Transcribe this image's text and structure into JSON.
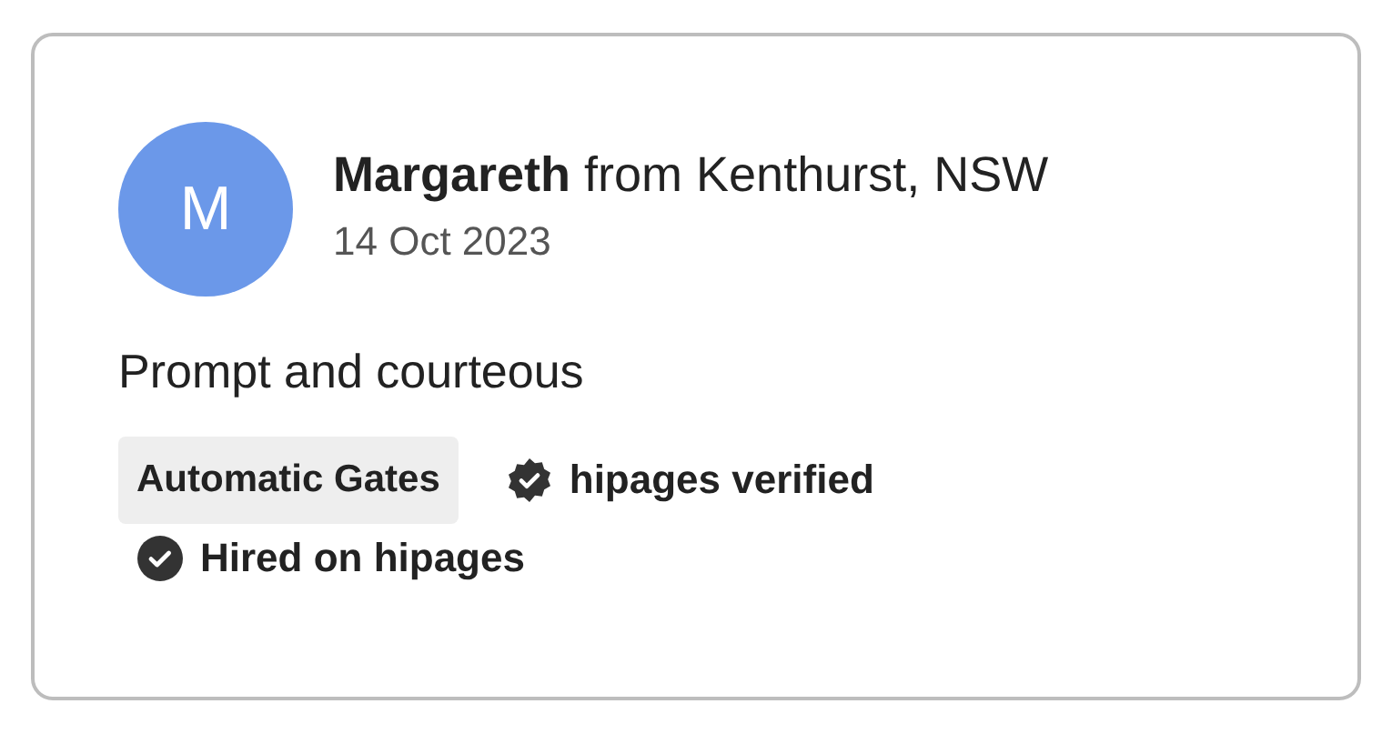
{
  "review": {
    "avatar_initial": "M",
    "heading": "**Margareth** from Kenthurst, NSW",
    "date": "14 Oct 2023",
    "comment": "Prompt and courteous",
    "tags": [
      {
        "label": "Automatic Gates"
      }
    ],
    "badges": [
      {
        "kind": "verified",
        "label": "hipages verified"
      },
      {
        "kind": "hired",
        "label": "Hired on hipages"
      }
    ]
  }
}
